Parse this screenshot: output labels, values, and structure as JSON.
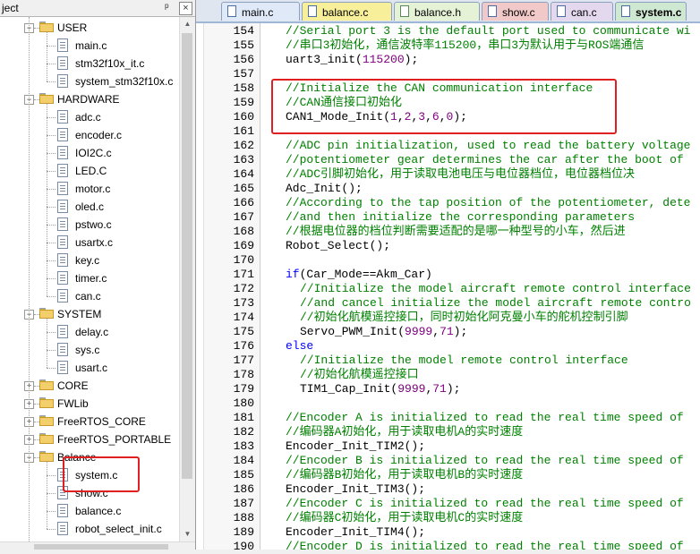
{
  "project_panel": {
    "title": "ject",
    "pin_glyph": "ᵖ",
    "close_glyph": "×",
    "tree": [
      {
        "kind": "file",
        "label": "main.c",
        "indent": 2
      },
      {
        "kind": "file",
        "label": "stm32f10x_it.c",
        "indent": 2
      },
      {
        "kind": "file",
        "label": "system_stm32f10x.c",
        "indent": 2
      },
      {
        "kind": "folder",
        "label": "HARDWARE",
        "expanded": true,
        "indent": 1
      },
      {
        "kind": "file",
        "label": "adc.c",
        "indent": 2
      },
      {
        "kind": "file",
        "label": "encoder.c",
        "indent": 2
      },
      {
        "kind": "file",
        "label": "IOI2C.c",
        "indent": 2
      },
      {
        "kind": "file",
        "label": "LED.C",
        "indent": 2
      },
      {
        "kind": "file",
        "label": "motor.c",
        "indent": 2
      },
      {
        "kind": "file",
        "label": "oled.c",
        "indent": 2
      },
      {
        "kind": "file",
        "label": "pstwo.c",
        "indent": 2
      },
      {
        "kind": "file",
        "label": "usartx.c",
        "indent": 2
      },
      {
        "kind": "file",
        "label": "key.c",
        "indent": 2
      },
      {
        "kind": "file",
        "label": "timer.c",
        "indent": 2
      },
      {
        "kind": "file",
        "label": "can.c",
        "indent": 2
      },
      {
        "kind": "folder",
        "label": "SYSTEM",
        "expanded": true,
        "indent": 1
      },
      {
        "kind": "file",
        "label": "delay.c",
        "indent": 2
      },
      {
        "kind": "file",
        "label": "sys.c",
        "indent": 2
      },
      {
        "kind": "file",
        "label": "usart.c",
        "indent": 2
      },
      {
        "kind": "folder",
        "label": "CORE",
        "expanded": false,
        "indent": 1
      },
      {
        "kind": "folder",
        "label": "FWLib",
        "expanded": false,
        "indent": 1
      },
      {
        "kind": "folder",
        "label": "FreeRTOS_CORE",
        "expanded": false,
        "indent": 1
      },
      {
        "kind": "folder",
        "label": "FreeRTOS_PORTABLE",
        "expanded": false,
        "indent": 1
      },
      {
        "kind": "folder",
        "label": "Balance",
        "expanded": true,
        "indent": 1
      },
      {
        "kind": "file",
        "label": "system.c",
        "indent": 2
      },
      {
        "kind": "file",
        "label": "show.c",
        "indent": 2
      },
      {
        "kind": "file",
        "label": "balance.c",
        "indent": 2
      },
      {
        "kind": "file",
        "label": "robot_select_init.c",
        "indent": 2
      }
    ],
    "top_folder": "USER"
  },
  "tabs": [
    {
      "label": "main.c",
      "color": "#dfe9f8",
      "icon": "c-file-icon"
    },
    {
      "label": "balance.c",
      "color": "#f7ef9a",
      "icon": "c-file-icon"
    },
    {
      "label": "balance.h",
      "color": "#e6f2d6",
      "icon": "h-file-icon"
    },
    {
      "label": "show.c",
      "color": "#f2c9c9",
      "icon": "c-file-icon"
    },
    {
      "label": "can.c",
      "color": "#e4d8ef",
      "icon": "c-file-icon"
    },
    {
      "label": "system.c",
      "color": "#cfe8d2",
      "icon": "c-file-icon",
      "active": true
    }
  ],
  "editor": {
    "lines": [
      {
        "n": "154",
        "indent": 0,
        "parts": [
          [
            "cm",
            "//Serial port 3 is the default port used to communicate wi"
          ]
        ]
      },
      {
        "n": "155",
        "indent": 0,
        "parts": [
          [
            "cm",
            "//串口3初始化，通信波特率115200，串口3为默认用于与ROS端通信"
          ]
        ]
      },
      {
        "n": "156",
        "indent": 0,
        "parts": [
          [
            "id",
            "uart3_init("
          ],
          [
            "num",
            "115200"
          ],
          [
            "id",
            ");"
          ]
        ]
      },
      {
        "n": "157",
        "indent": 0,
        "parts": []
      },
      {
        "n": "158",
        "indent": 0,
        "parts": [
          [
            "cm",
            "//Initialize the CAN communication interface"
          ]
        ]
      },
      {
        "n": "159",
        "indent": 0,
        "parts": [
          [
            "cm",
            "//CAN通信接口初始化"
          ]
        ]
      },
      {
        "n": "160",
        "indent": 0,
        "parts": [
          [
            "id",
            "CAN1_Mode_Init("
          ],
          [
            "num",
            "1"
          ],
          [
            "id",
            ","
          ],
          [
            "num",
            "2"
          ],
          [
            "id",
            ","
          ],
          [
            "num",
            "3"
          ],
          [
            "id",
            ","
          ],
          [
            "num",
            "6"
          ],
          [
            "id",
            ","
          ],
          [
            "num",
            "0"
          ],
          [
            "id",
            ");"
          ]
        ]
      },
      {
        "n": "161",
        "indent": 0,
        "parts": []
      },
      {
        "n": "162",
        "indent": 0,
        "parts": [
          [
            "cm",
            "//ADC pin initialization, used to read the battery voltage"
          ]
        ]
      },
      {
        "n": "163",
        "indent": 0,
        "parts": [
          [
            "cm",
            "//potentiometer gear determines the car after the boot of"
          ]
        ]
      },
      {
        "n": "164",
        "indent": 0,
        "parts": [
          [
            "cm",
            "//ADC引脚初始化，用于读取电池电压与电位器档位，电位器档位决"
          ]
        ]
      },
      {
        "n": "165",
        "indent": 0,
        "parts": [
          [
            "id",
            "Adc_Init();"
          ]
        ]
      },
      {
        "n": "166",
        "indent": 0,
        "parts": [
          [
            "cm",
            "//According to the tap position of the potentiometer, dete"
          ]
        ]
      },
      {
        "n": "167",
        "indent": 0,
        "parts": [
          [
            "cm",
            "//and then initialize the corresponding parameters"
          ]
        ]
      },
      {
        "n": "168",
        "indent": 0,
        "parts": [
          [
            "cm",
            "//根据电位器的档位判断需要适配的是哪一种型号的小车，然后进"
          ]
        ]
      },
      {
        "n": "169",
        "indent": 0,
        "parts": [
          [
            "id",
            "Robot_Select();"
          ]
        ]
      },
      {
        "n": "170",
        "indent": 0,
        "parts": []
      },
      {
        "n": "171",
        "indent": 0,
        "parts": [
          [
            "kw",
            "if"
          ],
          [
            "id",
            "(Car_Mode==Akm_Car)"
          ]
        ]
      },
      {
        "n": "172",
        "indent": 1,
        "parts": [
          [
            "cm",
            "//Initialize the model aircraft remote control interface"
          ]
        ]
      },
      {
        "n": "173",
        "indent": 1,
        "parts": [
          [
            "cm",
            "//and cancel initialize the model aircraft remote contro"
          ]
        ]
      },
      {
        "n": "174",
        "indent": 1,
        "parts": [
          [
            "cm",
            "//初始化航模遥控接口，同时初始化阿克曼小车的舵机控制引脚"
          ]
        ]
      },
      {
        "n": "175",
        "indent": 1,
        "parts": [
          [
            "id",
            "Servo_PWM_Init("
          ],
          [
            "num",
            "9999"
          ],
          [
            "id",
            ","
          ],
          [
            "num",
            "71"
          ],
          [
            "id",
            ");"
          ]
        ]
      },
      {
        "n": "176",
        "indent": 0,
        "parts": [
          [
            "kw",
            "else"
          ]
        ]
      },
      {
        "n": "177",
        "indent": 1,
        "parts": [
          [
            "cm",
            "//Initialize the model remote control interface"
          ]
        ]
      },
      {
        "n": "178",
        "indent": 1,
        "parts": [
          [
            "cm",
            "//初始化航模遥控接口"
          ]
        ]
      },
      {
        "n": "179",
        "indent": 1,
        "parts": [
          [
            "id",
            "TIM1_Cap_Init("
          ],
          [
            "num",
            "9999"
          ],
          [
            "id",
            ","
          ],
          [
            "num",
            "71"
          ],
          [
            "id",
            ");"
          ]
        ]
      },
      {
        "n": "180",
        "indent": 0,
        "parts": []
      },
      {
        "n": "181",
        "indent": 0,
        "parts": [
          [
            "cm",
            "//Encoder A is initialized to read the real time speed of"
          ]
        ]
      },
      {
        "n": "182",
        "indent": 0,
        "parts": [
          [
            "cm",
            "//编码器A初始化，用于读取电机A的实时速度"
          ]
        ]
      },
      {
        "n": "183",
        "indent": 0,
        "parts": [
          [
            "id",
            "Encoder_Init_TIM2();"
          ]
        ]
      },
      {
        "n": "184",
        "indent": 0,
        "parts": [
          [
            "cm",
            "//Encoder B is initialized to read the real time speed of"
          ]
        ]
      },
      {
        "n": "185",
        "indent": 0,
        "parts": [
          [
            "cm",
            "//编码器B初始化，用于读取电机B的实时速度"
          ]
        ]
      },
      {
        "n": "186",
        "indent": 0,
        "parts": [
          [
            "id",
            "Encoder_Init_TIM3();"
          ]
        ]
      },
      {
        "n": "187",
        "indent": 0,
        "parts": [
          [
            "cm",
            "//Encoder C is initialized to read the real time speed of"
          ]
        ]
      },
      {
        "n": "188",
        "indent": 0,
        "parts": [
          [
            "cm",
            "//编码器C初始化，用于读取电机C的实时速度"
          ]
        ]
      },
      {
        "n": "189",
        "indent": 0,
        "parts": [
          [
            "id",
            "Encoder_Init_TIM4();"
          ]
        ]
      },
      {
        "n": "190",
        "indent": 0,
        "parts": [
          [
            "cm",
            "//Encoder D is initialized to read the real time speed of"
          ]
        ]
      }
    ]
  },
  "colors": {
    "highlight_box": "#e02020",
    "comment": "#008000",
    "number": "#800080",
    "keyword": "#0000ff"
  }
}
